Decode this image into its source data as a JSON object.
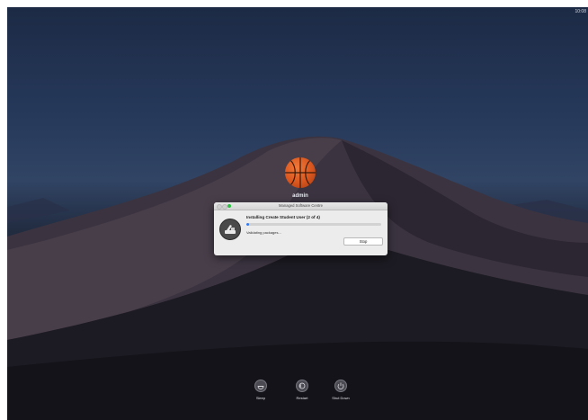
{
  "clock": "10:08",
  "user": {
    "name": "admin",
    "avatar_icon": "basketball-icon"
  },
  "dialog": {
    "window_title": "Managed Software Centre",
    "title": "Installing Create Student User (2 of 4)",
    "status": "Validating packages...",
    "progress": 0.02,
    "stop_label": "Stop",
    "app_icon": "managed-software-centre-icon",
    "accent_color": "#2f7cf6"
  },
  "power": [
    {
      "id": "sleep",
      "label": "Sleep",
      "icon": "sleep-icon"
    },
    {
      "id": "restart",
      "label": "Restart",
      "icon": "restart-icon"
    },
    {
      "id": "shutdown",
      "label": "Shut Down",
      "icon": "power-icon"
    }
  ]
}
